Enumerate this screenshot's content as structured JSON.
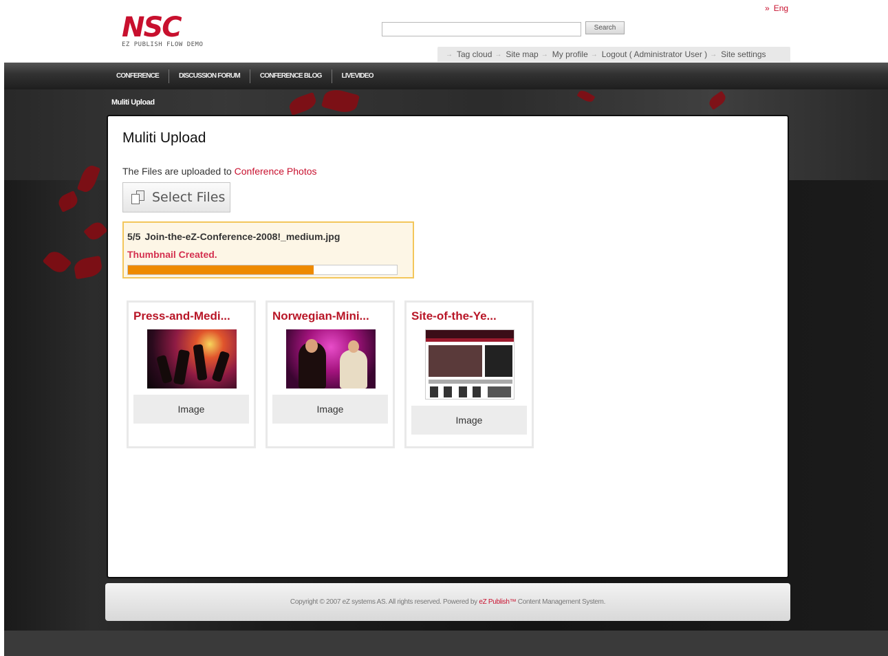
{
  "header": {
    "logo_text": "NSC",
    "logo_subtitle": "EZ PUBLISH FLOW DEMO",
    "language_link": "Eng",
    "search_value": "",
    "search_button": "Search",
    "user_links": [
      {
        "label": "Tag cloud"
      },
      {
        "label": "Site map"
      },
      {
        "label": "My profile"
      },
      {
        "label": "Logout ( Administrator User )"
      },
      {
        "label": "Site settings"
      }
    ]
  },
  "nav": {
    "items": [
      {
        "label": "CONFERENCE"
      },
      {
        "label": "DISCUSSION FORUM"
      },
      {
        "label": "CONFERENCE BLOG"
      },
      {
        "label": "LIVEVIDEO"
      }
    ]
  },
  "breadcrumb": "Muliti Upload",
  "main": {
    "title": "Muliti Upload",
    "info_prefix": "The Files are uploaded to",
    "info_link": "Conference Photos",
    "select_button": "Select Files",
    "upload": {
      "count": "5/5",
      "filename": "Join-the-eZ-Conference-2008!_medium.jpg",
      "status": "Thumbnail Created.",
      "progress_fraction": 0.69
    },
    "cards": [
      {
        "title": "Press-and-Medi...",
        "type": "Image",
        "thumb_icon": "stage-photo-thumbnail"
      },
      {
        "title": "Norwegian-Mini...",
        "type": "Image",
        "thumb_icon": "award-photo-thumbnail"
      },
      {
        "title": "Site-of-the-Ye...",
        "type": "Image",
        "thumb_icon": "website-screenshot-thumbnail"
      }
    ]
  },
  "footer": {
    "prefix": "Copyright © 2007 eZ systems AS. All rights reserved. Powered by",
    "link": "eZ Publish™",
    "suffix": "Content Management System."
  },
  "colors": {
    "brand_red": "#c8102e",
    "progress_orange": "#ee8a00",
    "upload_border": "#f3c65a",
    "upload_bg": "#fdf6e6"
  }
}
